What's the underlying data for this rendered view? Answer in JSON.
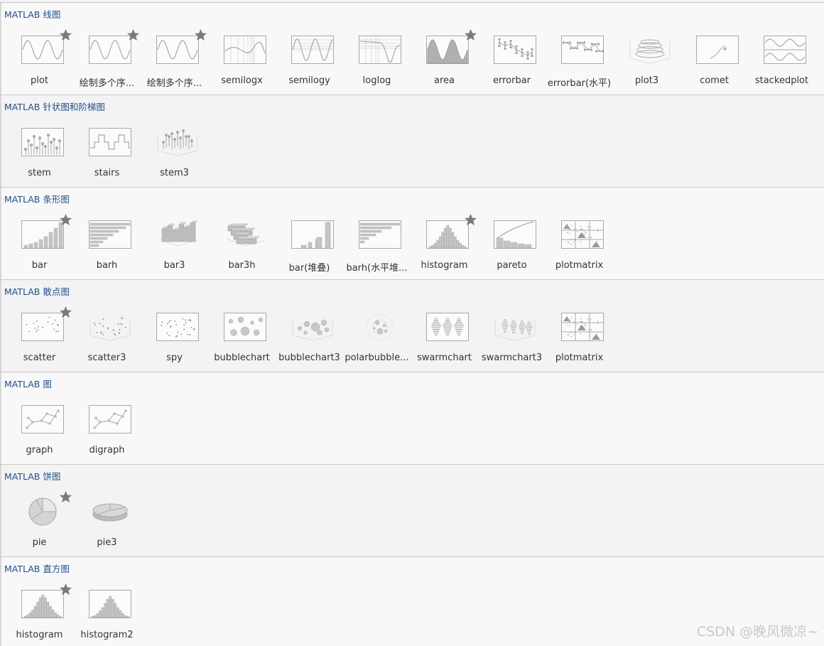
{
  "sections": [
    {
      "title": "MATLAB 线图",
      "items": [
        {
          "label": "plot",
          "icon": "sine-plot-icon",
          "starred": true
        },
        {
          "label": "绘制多个序...",
          "icon": "sine-plot-icon",
          "starred": true
        },
        {
          "label": "绘制多个序...",
          "icon": "sine-plot-icon",
          "starred": true
        },
        {
          "label": "semilogx",
          "icon": "semilogx-icon",
          "starred": false
        },
        {
          "label": "semilogy",
          "icon": "semilogy-icon",
          "starred": false
        },
        {
          "label": "loglog",
          "icon": "loglog-icon",
          "starred": false
        },
        {
          "label": "area",
          "icon": "area-icon",
          "starred": true
        },
        {
          "label": "errorbar",
          "icon": "errorbar-icon",
          "starred": false
        },
        {
          "label": "errorbar(水平)",
          "icon": "errorbar-horizontal-icon",
          "starred": false
        },
        {
          "label": "plot3",
          "icon": "plot3-icon",
          "starred": false
        },
        {
          "label": "comet",
          "icon": "comet-icon",
          "starred": false
        },
        {
          "label": "stackedplot",
          "icon": "stackedplot-icon",
          "starred": false
        }
      ]
    },
    {
      "title": "MATLAB 针状图和阶梯图",
      "items": [
        {
          "label": "stem",
          "icon": "stem-icon",
          "starred": false
        },
        {
          "label": "stairs",
          "icon": "stairs-icon",
          "starred": false
        },
        {
          "label": "stem3",
          "icon": "stem3-icon",
          "starred": false
        }
      ]
    },
    {
      "title": "MATLAB 条形图",
      "items": [
        {
          "label": "bar",
          "icon": "bar-icon",
          "starred": true
        },
        {
          "label": "barh",
          "icon": "barh-icon",
          "starred": false
        },
        {
          "label": "bar3",
          "icon": "bar3-icon",
          "starred": false
        },
        {
          "label": "bar3h",
          "icon": "bar3h-icon",
          "starred": false
        },
        {
          "label": "bar(堆叠)",
          "icon": "bar-stacked-icon",
          "starred": false
        },
        {
          "label": "barh(水平堆...",
          "icon": "barh-stacked-icon",
          "starred": false
        },
        {
          "label": "histogram",
          "icon": "histogram-icon",
          "starred": true
        },
        {
          "label": "pareto",
          "icon": "pareto-icon",
          "starred": false
        },
        {
          "label": "plotmatrix",
          "icon": "plotmatrix-icon",
          "starred": false
        }
      ]
    },
    {
      "title": "MATLAB 散点图",
      "items": [
        {
          "label": "scatter",
          "icon": "scatter-icon",
          "starred": true
        },
        {
          "label": "scatter3",
          "icon": "scatter3-icon",
          "starred": false
        },
        {
          "label": "spy",
          "icon": "spy-icon",
          "starred": false
        },
        {
          "label": "bubblechart",
          "icon": "bubblechart-icon",
          "starred": false
        },
        {
          "label": "bubblechart3",
          "icon": "bubblechart3-icon",
          "starred": false
        },
        {
          "label": "polarbubble...",
          "icon": "polarbubble-icon",
          "starred": false
        },
        {
          "label": "swarmchart",
          "icon": "swarmchart-icon",
          "starred": false
        },
        {
          "label": "swarmchart3",
          "icon": "swarmchart3-icon",
          "starred": false
        },
        {
          "label": "plotmatrix",
          "icon": "plotmatrix-icon",
          "starred": false
        }
      ]
    },
    {
      "title": "MATLAB 图",
      "items": [
        {
          "label": "graph",
          "icon": "graph-icon",
          "starred": false
        },
        {
          "label": "digraph",
          "icon": "digraph-icon",
          "starred": false
        }
      ]
    },
    {
      "title": "MATLAB 饼图",
      "items": [
        {
          "label": "pie",
          "icon": "pie-icon",
          "starred": true
        },
        {
          "label": "pie3",
          "icon": "pie3-icon",
          "starred": false
        }
      ]
    },
    {
      "title": "MATLAB 直方图",
      "items": [
        {
          "label": "histogram",
          "icon": "histogram-icon",
          "starred": true
        },
        {
          "label": "histogram2",
          "icon": "histogram2-icon",
          "starred": false
        }
      ]
    }
  ],
  "watermark": "CSDN @晚风微凉~",
  "colors": {
    "section_title": "#1f4e8a",
    "thumb_stroke": "#a8a8a8",
    "star": "#7a7a7a"
  }
}
